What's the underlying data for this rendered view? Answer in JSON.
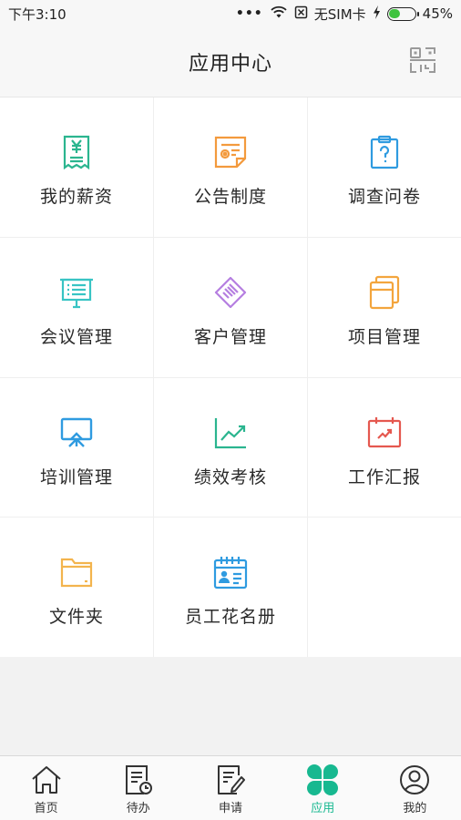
{
  "status_bar": {
    "time": "下午3:10",
    "dots": "•••",
    "sim": "无SIM卡",
    "battery": "45%",
    "battery_level": 0.45
  },
  "header": {
    "title": "应用中心",
    "scan_icon": "qr-scan-icon"
  },
  "apps": [
    {
      "label": "我的薪资",
      "icon": "salary-receipt-icon",
      "color": "#2bb58f"
    },
    {
      "label": "公告制度",
      "icon": "announcement-document-icon",
      "color": "#f39a3d"
    },
    {
      "label": "调查问卷",
      "icon": "survey-clipboard-icon",
      "color": "#2f9be0"
    },
    {
      "label": "会议管理",
      "icon": "meeting-board-icon",
      "color": "#38c4c4"
    },
    {
      "label": "客户管理",
      "icon": "handshake-icon",
      "color": "#b57ee0"
    },
    {
      "label": "项目管理",
      "icon": "project-files-icon",
      "color": "#f3a53d"
    },
    {
      "label": "培训管理",
      "icon": "training-presentation-icon",
      "color": "#2f9be0"
    },
    {
      "label": "绩效考核",
      "icon": "performance-chart-icon",
      "color": "#2bb58f"
    },
    {
      "label": "工作汇报",
      "icon": "work-report-calendar-icon",
      "color": "#e5584f"
    },
    {
      "label": "文件夹",
      "icon": "folder-icon",
      "color": "#f3b44d"
    },
    {
      "label": "员工花名册",
      "icon": "employee-roster-icon",
      "color": "#2f9be0"
    }
  ],
  "bottom_nav": [
    {
      "label": "首页",
      "icon": "home-icon"
    },
    {
      "label": "待办",
      "icon": "todo-list-icon"
    },
    {
      "label": "申请",
      "icon": "application-edit-icon"
    },
    {
      "label": "应用",
      "icon": "apps-clover-icon",
      "active": true
    },
    {
      "label": "我的",
      "icon": "profile-icon"
    }
  ],
  "colors": {
    "accent": "#17b890"
  }
}
